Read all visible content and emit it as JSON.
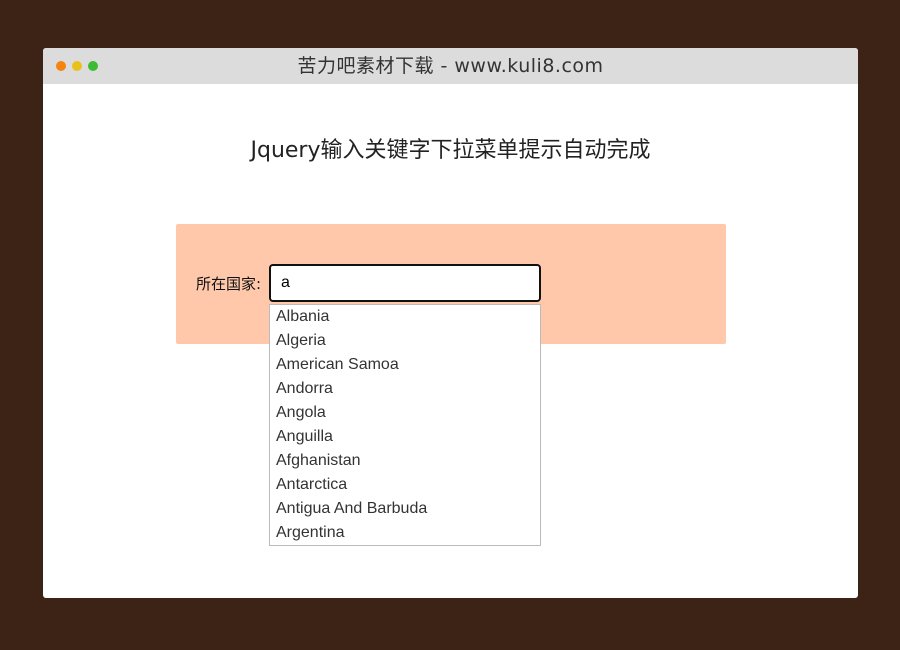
{
  "window": {
    "title": "苦力吧素材下载 - www.kuli8.com",
    "controls": {
      "close_color": "#f5830f",
      "minimize_color": "#e8c11c",
      "maximize_color": "#3dbb35"
    }
  },
  "page": {
    "title": "Jquery输入关键字下拉菜单提示自动完成"
  },
  "form": {
    "label": "所在国家:",
    "input_value": "a",
    "panel_color": "#ffc8ab"
  },
  "suggestions": [
    "Albania",
    "Algeria",
    "American Samoa",
    "Andorra",
    "Angola",
    "Anguilla",
    "Afghanistan",
    "Antarctica",
    "Antigua And Barbuda",
    "Argentina"
  ]
}
